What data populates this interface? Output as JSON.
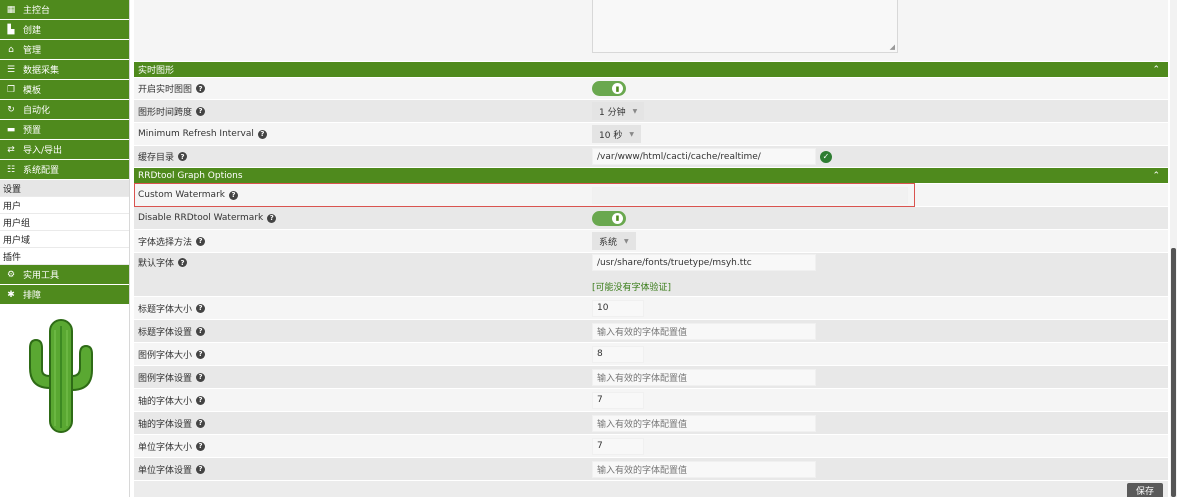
{
  "sidebar": {
    "menu": [
      {
        "label": "主控台",
        "icon": "map-icon"
      },
      {
        "label": "创建",
        "icon": "chart-icon"
      },
      {
        "label": "管理",
        "icon": "home-icon"
      },
      {
        "label": "数据采集",
        "icon": "database-icon"
      },
      {
        "label": "模板",
        "icon": "copy-icon"
      },
      {
        "label": "自动化",
        "icon": "refresh-icon"
      },
      {
        "label": "预置",
        "icon": "archive-icon"
      },
      {
        "label": "导入/导出",
        "icon": "exchange-icon"
      },
      {
        "label": "系统配置",
        "icon": "sliders-icon"
      }
    ],
    "submenu": [
      {
        "label": "设置"
      },
      {
        "label": "用户"
      },
      {
        "label": "用户组"
      },
      {
        "label": "用户域"
      },
      {
        "label": "插件"
      }
    ],
    "menu2": [
      {
        "label": "实用工具",
        "icon": "cogs-icon"
      },
      {
        "label": "排障",
        "icon": "bug-icon"
      }
    ]
  },
  "sections": {
    "realtime": "实时图形",
    "rrdtool": "RRDtool Graph Options",
    "collapse_icon": "chevron-up-icon"
  },
  "fields": {
    "realtime_enable": {
      "label": "开启实时图图"
    },
    "graph_timespan": {
      "label": "图形时间跨度",
      "value": "1 分钟"
    },
    "min_refresh": {
      "label": "Minimum Refresh Interval",
      "value": "10 秒"
    },
    "cache_dir": {
      "label": "缓存目录",
      "value": "/var/www/html/cacti/cache/realtime/"
    },
    "custom_watermark": {
      "label": "Custom Watermark",
      "value": ""
    },
    "disable_watermark": {
      "label": "Disable RRDtool Watermark"
    },
    "font_method": {
      "label": "字体选择方法",
      "value": "系统"
    },
    "default_font": {
      "label": "默认字体",
      "value": "/usr/share/fonts/truetype/msyh.ttc",
      "note": "[可能没有字体验证]"
    },
    "title_size": {
      "label": "标题字体大小",
      "value": "10"
    },
    "title_font": {
      "label": "标题字体设置",
      "placeholder": "输入有效的字体配置值"
    },
    "legend_size": {
      "label": "图例字体大小",
      "value": "8"
    },
    "legend_font": {
      "label": "图例字体设置",
      "placeholder": "输入有效的字体配置值"
    },
    "axis_size": {
      "label": "轴的字体大小",
      "value": "7"
    },
    "axis_font": {
      "label": "轴的字体设置",
      "placeholder": "输入有效的字体配置值"
    },
    "unit_size": {
      "label": "单位字体大小",
      "value": "7"
    },
    "unit_font": {
      "label": "单位字体设置",
      "placeholder": "输入有效的字体配置值"
    }
  },
  "buttons": {
    "save": "保存"
  },
  "colors": {
    "accent": "#4f8a1d",
    "toggle_on": "#6aa84f",
    "error_outline": "#d9534f"
  }
}
